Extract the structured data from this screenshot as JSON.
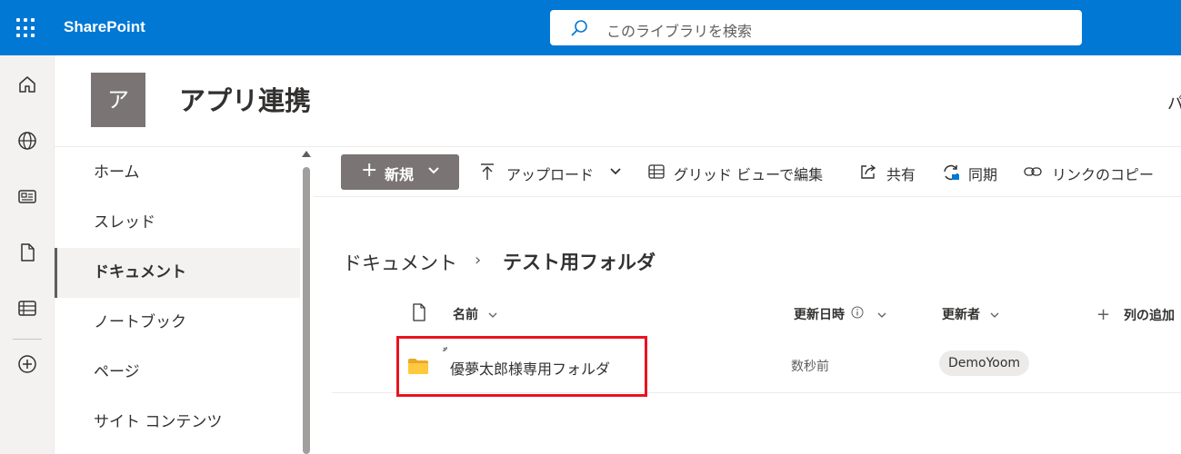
{
  "topbar": {
    "app_name": "SharePoint",
    "search_placeholder": "このライブラリを検索",
    "brand_color": "#0078d4"
  },
  "rail": {
    "icons": [
      "home-icon",
      "globe-icon",
      "news-icon",
      "document-icon",
      "lists-icon",
      "add-circle-icon"
    ]
  },
  "site": {
    "logo_letter": "ア",
    "title": "アプリ連携",
    "right_partial": "パ"
  },
  "leftnav": {
    "items": [
      {
        "label": "ホーム",
        "active": false
      },
      {
        "label": "スレッド",
        "active": false
      },
      {
        "label": "ドキュメント",
        "active": true
      },
      {
        "label": "ノートブック",
        "active": false
      },
      {
        "label": "ページ",
        "active": false
      },
      {
        "label": "サイト コンテンツ",
        "active": false
      }
    ]
  },
  "commandbar": {
    "new_label": "新規",
    "upload_label": "アップロード",
    "grid_label": "グリッド ビューで編集",
    "share_label": "共有",
    "sync_label": "同期",
    "copy_link_label": "リンクのコピー"
  },
  "breadcrumb": {
    "root": "ドキュメント",
    "separator": "›",
    "current": "テスト用フォルダ"
  },
  "list": {
    "columns": {
      "name": "名前",
      "modified": "更新日時",
      "modified_by": "更新者",
      "add_column": "列の追加"
    },
    "rows": [
      {
        "name": "優夢太郎様専用フォルダ",
        "modified": "数秒前",
        "modified_by": "DemoYoom"
      }
    ]
  },
  "annotation": {
    "highlight_color": "#e8141f"
  }
}
